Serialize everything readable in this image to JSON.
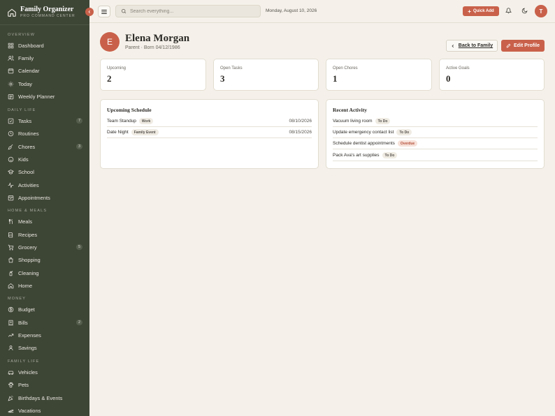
{
  "app": {
    "title": "Family Organizer",
    "subtitle": "PRO COMMAND CENTER"
  },
  "sidebar": {
    "sections": [
      {
        "label": "OVERVIEW",
        "items": [
          {
            "label": "Dashboard",
            "icon": "grid-icon"
          },
          {
            "label": "Family",
            "icon": "users-icon"
          },
          {
            "label": "Calendar",
            "icon": "calendar-icon"
          },
          {
            "label": "Today",
            "icon": "sun-icon"
          },
          {
            "label": "Weekly Planner",
            "icon": "planner-icon"
          }
        ]
      },
      {
        "label": "DAILY LIFE",
        "items": [
          {
            "label": "Tasks",
            "icon": "checkbox-icon",
            "count": "7"
          },
          {
            "label": "Routines",
            "icon": "clock-icon"
          },
          {
            "label": "Chores",
            "icon": "broom-icon",
            "count": "3"
          },
          {
            "label": "Kids",
            "icon": "smile-icon"
          },
          {
            "label": "School",
            "icon": "school-icon"
          },
          {
            "label": "Activities",
            "icon": "activity-icon"
          },
          {
            "label": "Appointments",
            "icon": "appointment-icon"
          }
        ]
      },
      {
        "label": "HOME & MEALS",
        "items": [
          {
            "label": "Meals",
            "icon": "utensils-icon"
          },
          {
            "label": "Recipes",
            "icon": "book-icon"
          },
          {
            "label": "Grocery",
            "icon": "cart-icon",
            "count": "5"
          },
          {
            "label": "Shopping",
            "icon": "bag-icon"
          },
          {
            "label": "Cleaning",
            "icon": "spray-icon"
          },
          {
            "label": "Home",
            "icon": "home-icon"
          }
        ]
      },
      {
        "label": "MONEY",
        "items": [
          {
            "label": "Budget",
            "icon": "dollar-icon"
          },
          {
            "label": "Bills",
            "icon": "receipt-icon",
            "count": "2"
          },
          {
            "label": "Expenses",
            "icon": "trend-icon"
          },
          {
            "label": "Savings",
            "icon": "piggy-icon"
          }
        ]
      },
      {
        "label": "FAMILY LIFE",
        "items": [
          {
            "label": "Vehicles",
            "icon": "car-icon"
          },
          {
            "label": "Pets",
            "icon": "paw-icon"
          },
          {
            "label": "Birthdays & Events",
            "icon": "gift-icon"
          },
          {
            "label": "Vacations",
            "icon": "plane-icon"
          }
        ]
      }
    ]
  },
  "topbar": {
    "search_placeholder": "Search everything...",
    "date": "Monday, August 10, 2026",
    "quick_add": "Quick Add",
    "user_initial": "T"
  },
  "profile": {
    "initial": "E",
    "name": "Elena Morgan",
    "meta": "Parent · Born 04/12/1986",
    "back_label": "Back to Family",
    "edit_label": "Edit Profile"
  },
  "stats": [
    {
      "label": "Upcoming",
      "value": "2"
    },
    {
      "label": "Open Tasks",
      "value": "3"
    },
    {
      "label": "Open Chores",
      "value": "1"
    },
    {
      "label": "Active Goals",
      "value": "0"
    }
  ],
  "schedule": {
    "title": "Upcoming Schedule",
    "rows": [
      {
        "label": "Team Standup",
        "badge": "Work",
        "date": "08/10/2026"
      },
      {
        "label": "Date Night",
        "badge": "Family Event",
        "date": "08/15/2026"
      }
    ]
  },
  "activity": {
    "title": "Recent Activity",
    "rows": [
      {
        "label": "Vacuum living room",
        "badge": "To Do",
        "status": "todo"
      },
      {
        "label": "Update emergency contact list",
        "badge": "To Do",
        "status": "todo"
      },
      {
        "label": "Schedule dentist appointments",
        "badge": "Overdue",
        "status": "overdue"
      },
      {
        "label": "Pack Ava's art supplies",
        "badge": "To Do",
        "status": "todo"
      }
    ]
  },
  "colors": {
    "accent": "#c9614a",
    "sidebar": "#3d4535",
    "background": "#f5f1ea"
  }
}
